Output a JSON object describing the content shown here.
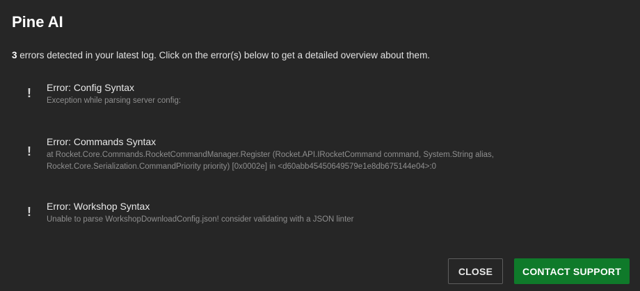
{
  "dialog": {
    "title": "Pine AI",
    "summary": {
      "count": "3",
      "text": " errors detected in your latest log. Click on the error(s) below to get a detailed overview about them."
    },
    "errors": [
      {
        "icon": "exclamation-icon",
        "title": "Error: Config Syntax",
        "detail": "Exception while parsing server config:"
      },
      {
        "icon": "exclamation-icon",
        "title": "Error: Commands Syntax",
        "detail": "at Rocket.Core.Commands.RocketCommandManager.Register (Rocket.API.IRocketCommand command, System.String alias, Rocket.Core.Serialization.CommandPriority priority) [0x0002e] in <d60abb45450649579e1e8db675144e04>:0"
      },
      {
        "icon": "exclamation-icon",
        "title": "Error: Workshop Syntax",
        "detail": "Unable to parse WorkshopDownloadConfig.json! consider validating with a JSON linter"
      }
    ],
    "buttons": {
      "close_label": "CLOSE",
      "support_label": "CONTACT SUPPORT"
    }
  },
  "colors": {
    "background": "#262626",
    "primary_button": "#0f7a2a",
    "detail_text": "#8f8f8f"
  }
}
